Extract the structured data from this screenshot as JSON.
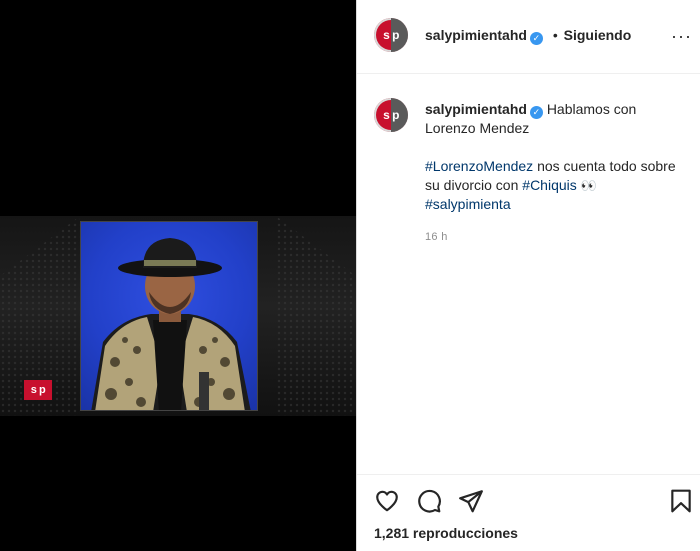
{
  "media": {
    "watermark": "s p"
  },
  "header": {
    "avatar_text": "s p",
    "username": "salypimientahd",
    "verified_mark": "✓",
    "separator": "•",
    "follow_state": "Siguiendo",
    "more_label": "···"
  },
  "caption": {
    "avatar_text": "s p",
    "username": "salypimientahd",
    "text_intro": "Hablamos con Lorenzo Mendez",
    "tag1": "#LorenzoMendez",
    "text_mid": " nos cuenta todo sobre su divorcio con ",
    "tag2": "#Chiquis",
    "emoji": "👀",
    "tag3": "#salypimienta",
    "time": "16 h"
  },
  "actions": {
    "icons": [
      "heart-icon",
      "comment-icon",
      "share-icon",
      "bookmark-icon"
    ],
    "views": "1,281 reproducciones"
  },
  "colors": {
    "brand_red": "#c8102e",
    "link_blue": "#00376b",
    "verified_blue": "#3897f0",
    "video_bg_blue": "#2240c9"
  }
}
